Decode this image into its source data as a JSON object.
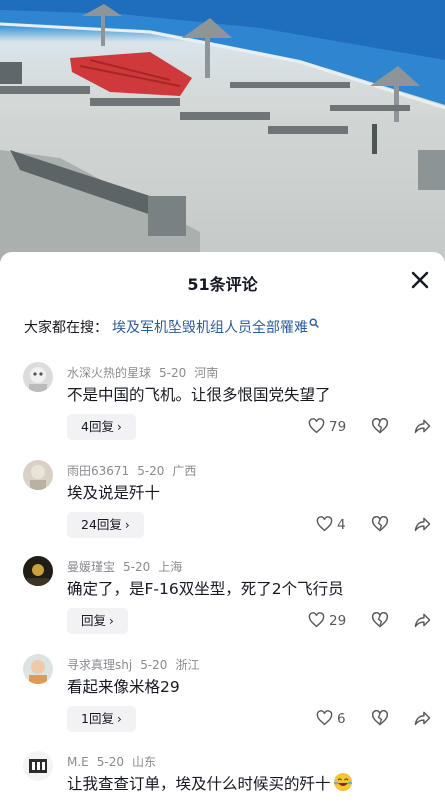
{
  "sheet": {
    "title": "51条评论",
    "search_lead": "大家都在搜：",
    "search_link": "埃及军机坠毁机组人员全部罹难"
  },
  "comments": [
    {
      "user": "水深火热的星球",
      "date": "5-20",
      "location": "河南",
      "text": "不是中国的飞机。让很多恨国党失望了",
      "replies": "4回复",
      "likes": "79"
    },
    {
      "user": "雨田63671",
      "date": "5-20",
      "location": "广西",
      "text": "埃及说是歼十",
      "replies": "24回复",
      "likes": "4"
    },
    {
      "user": "曼媛瑾宝",
      "date": "5-20",
      "location": "上海",
      "text": "确定了，是F-16双坐型，死了2个飞行员",
      "replies": "回复",
      "likes": "29"
    },
    {
      "user": "寻求真理shj",
      "date": "5-20",
      "location": "浙江",
      "text": "看起来像米格29",
      "replies": "1回复",
      "likes": "6"
    },
    {
      "user": "M.E",
      "date": "5-20",
      "location": "山东",
      "text": "让我查查订单，埃及什么时候买的歼十"
    }
  ],
  "icons": [
    "close-icon",
    "search-icon",
    "heart-icon",
    "broken-heart-icon",
    "share-icon",
    "laughing-emoji-icon"
  ]
}
